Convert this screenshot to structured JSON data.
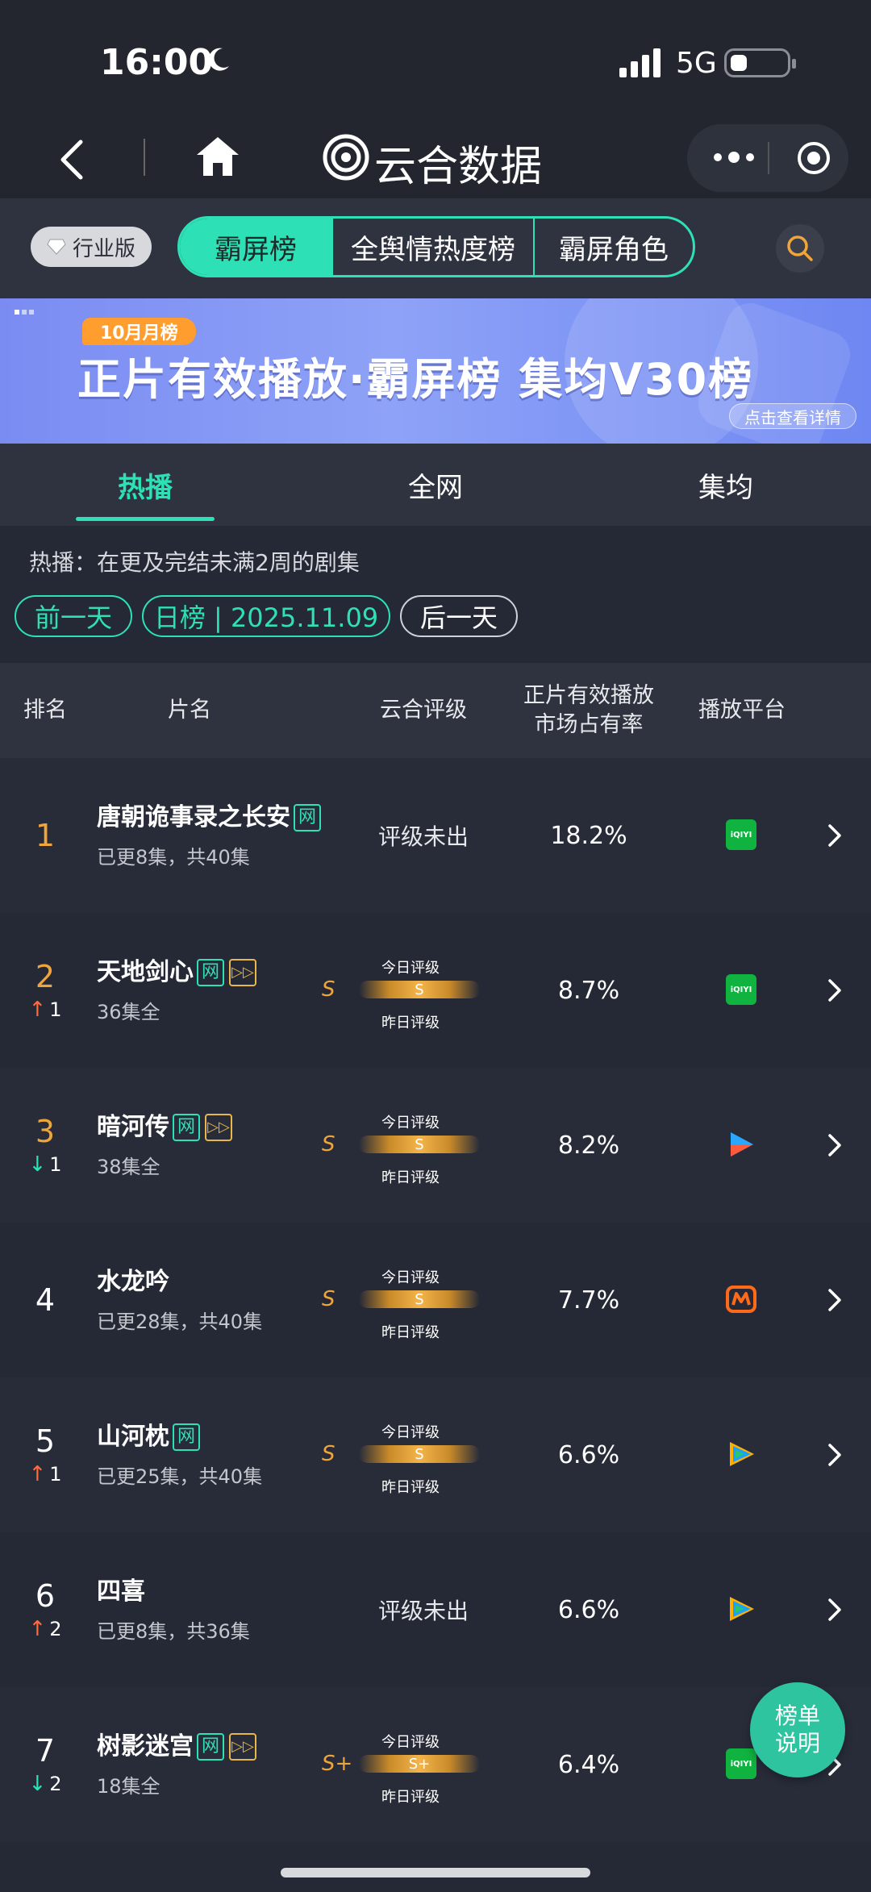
{
  "status_bar": {
    "time": "16:00",
    "network": "5G"
  },
  "nav": {
    "title": "云合数据"
  },
  "filter": {
    "edition_label": "行业版",
    "segments": [
      {
        "label": "霸屏榜",
        "active": true
      },
      {
        "label": "全舆情热度榜",
        "active": false
      },
      {
        "label": "霸屏角色",
        "active": false
      }
    ]
  },
  "banner": {
    "tag": "10月月榜",
    "title": "正片有效播放·霸屏榜 集均V30榜",
    "link": "点击查看详情"
  },
  "main_tabs": [
    {
      "label": "热播",
      "active": true
    },
    {
      "label": "全网",
      "active": false
    },
    {
      "label": "集均",
      "active": false
    }
  ],
  "description": "热播：在更及完结未满2周的剧集",
  "date_nav": {
    "prev": "前一天",
    "current": "日榜 | 2025.11.09",
    "next": "后一天"
  },
  "table": {
    "headers": {
      "rank": "排名",
      "name": "片名",
      "rating": "云合评级",
      "share_line1": "正片有效播放",
      "share_line2": "市场占有率",
      "platform": "播放平台"
    },
    "rating_labels": {
      "today": "今日评级",
      "yesterday": "昨日评级"
    },
    "rows": [
      {
        "rank": "1",
        "change": "",
        "name": "唐朝诡事录之长安",
        "tag_net": "网",
        "tag_play": "",
        "episodes": "已更8集，共40集",
        "rating": "评级未出",
        "share": "18.2%",
        "platform": "iqiyi-icon"
      },
      {
        "rank": "2",
        "change": "1",
        "direction": "up",
        "name": "天地剑心",
        "tag_net": "网",
        "tag_play": "▷▷",
        "episodes": "36集全",
        "rating_side": "S",
        "rating_mid": "S",
        "share": "8.7%",
        "platform": "iqiyi-icon"
      },
      {
        "rank": "3",
        "change": "1",
        "direction": "down",
        "name": "暗河传",
        "tag_net": "网",
        "tag_play": "▷▷",
        "episodes": "38集全",
        "rating_side": "S",
        "rating_mid": "S",
        "share": "8.2%",
        "platform": "youku-icon"
      },
      {
        "rank": "4",
        "change": "",
        "name": "水龙吟",
        "tag_net": "",
        "tag_play": "",
        "episodes": "已更28集，共40集",
        "rating_side": "S",
        "rating_mid": "S",
        "share": "7.7%",
        "platform": "mgtv-icon"
      },
      {
        "rank": "5",
        "change": "1",
        "direction": "up",
        "name": "山河枕",
        "tag_net": "网",
        "tag_play": "",
        "episodes": "已更25集，共40集",
        "rating_side": "S",
        "rating_mid": "S",
        "share": "6.6%",
        "platform": "tencent-video-icon"
      },
      {
        "rank": "6",
        "change": "2",
        "direction": "up",
        "name": "四喜",
        "tag_net": "",
        "tag_play": "",
        "episodes": "已更8集，共36集",
        "rating": "评级未出",
        "share": "6.6%",
        "platform": "tencent-video-icon"
      },
      {
        "rank": "7",
        "change": "2",
        "direction": "down",
        "name": "树影迷宫",
        "tag_net": "网",
        "tag_play": "▷▷",
        "episodes": "18集全",
        "rating_side": "S+",
        "rating_mid": "S+",
        "share": "6.4%",
        "platform": "iqiyi-icon"
      }
    ]
  },
  "float_button": {
    "line1": "榜单",
    "line2": "说明"
  },
  "colors": {
    "accent": "#2ee0b6",
    "gold": "#f0a53a",
    "up": "#ff6b3d",
    "down": "#2ee0b6",
    "iqiyi": "#10b33f"
  }
}
